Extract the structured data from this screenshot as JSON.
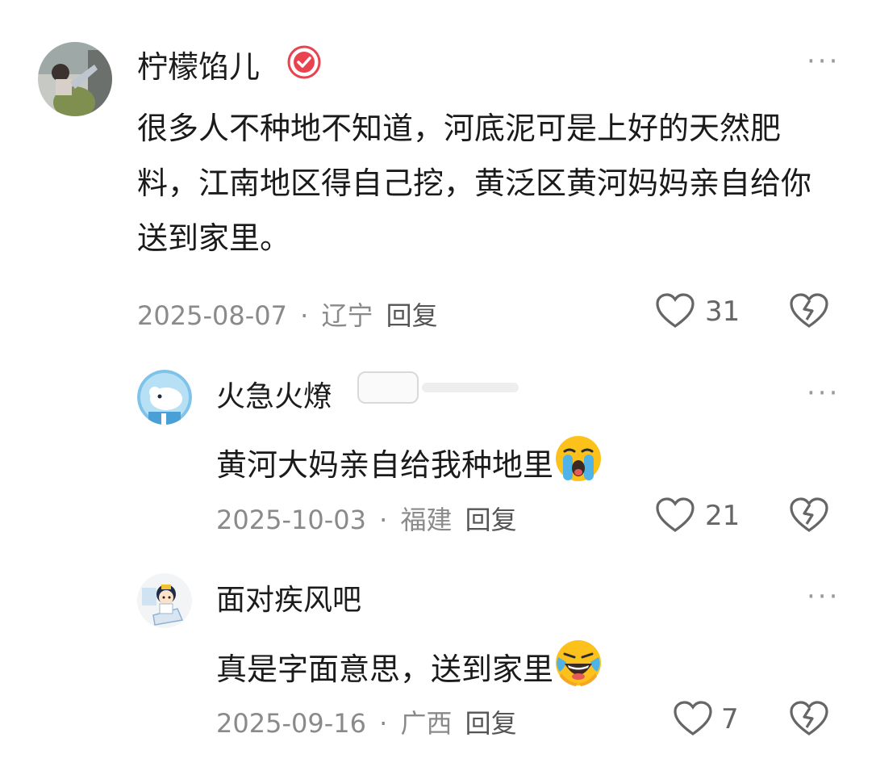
{
  "comments": [
    {
      "name": "柠檬馅儿",
      "text": "很多人不种地不知道，河底泥可是上好的天然肥料，江南地区得自己挖，黄泛区黄河妈妈亲自给你送到家里。",
      "date": "2025-08-07",
      "sep": "·",
      "location": "辽宁",
      "reply": "回复",
      "likes": "31",
      "verified": true
    },
    {
      "name": "火急火燎",
      "text": "黄河大妈亲自给我种地里",
      "emoji": "crying-face",
      "date": "2025-10-03",
      "sep": "·",
      "location": "福建",
      "reply": "回复",
      "likes": "21"
    },
    {
      "name": "面对疾风吧",
      "text": "真是字面意思，送到家里",
      "emoji": "laughing-crying-face",
      "date": "2025-09-16",
      "sep": "·",
      "location": "广西",
      "reply": "回复",
      "likes": "7"
    }
  ],
  "more_label": "···",
  "colors": {
    "accent_badge": "#e8434f",
    "emoji_yellow": "#fcc21b",
    "tear_blue": "#4fb3e8",
    "meta_gray": "#8a8a8a"
  }
}
